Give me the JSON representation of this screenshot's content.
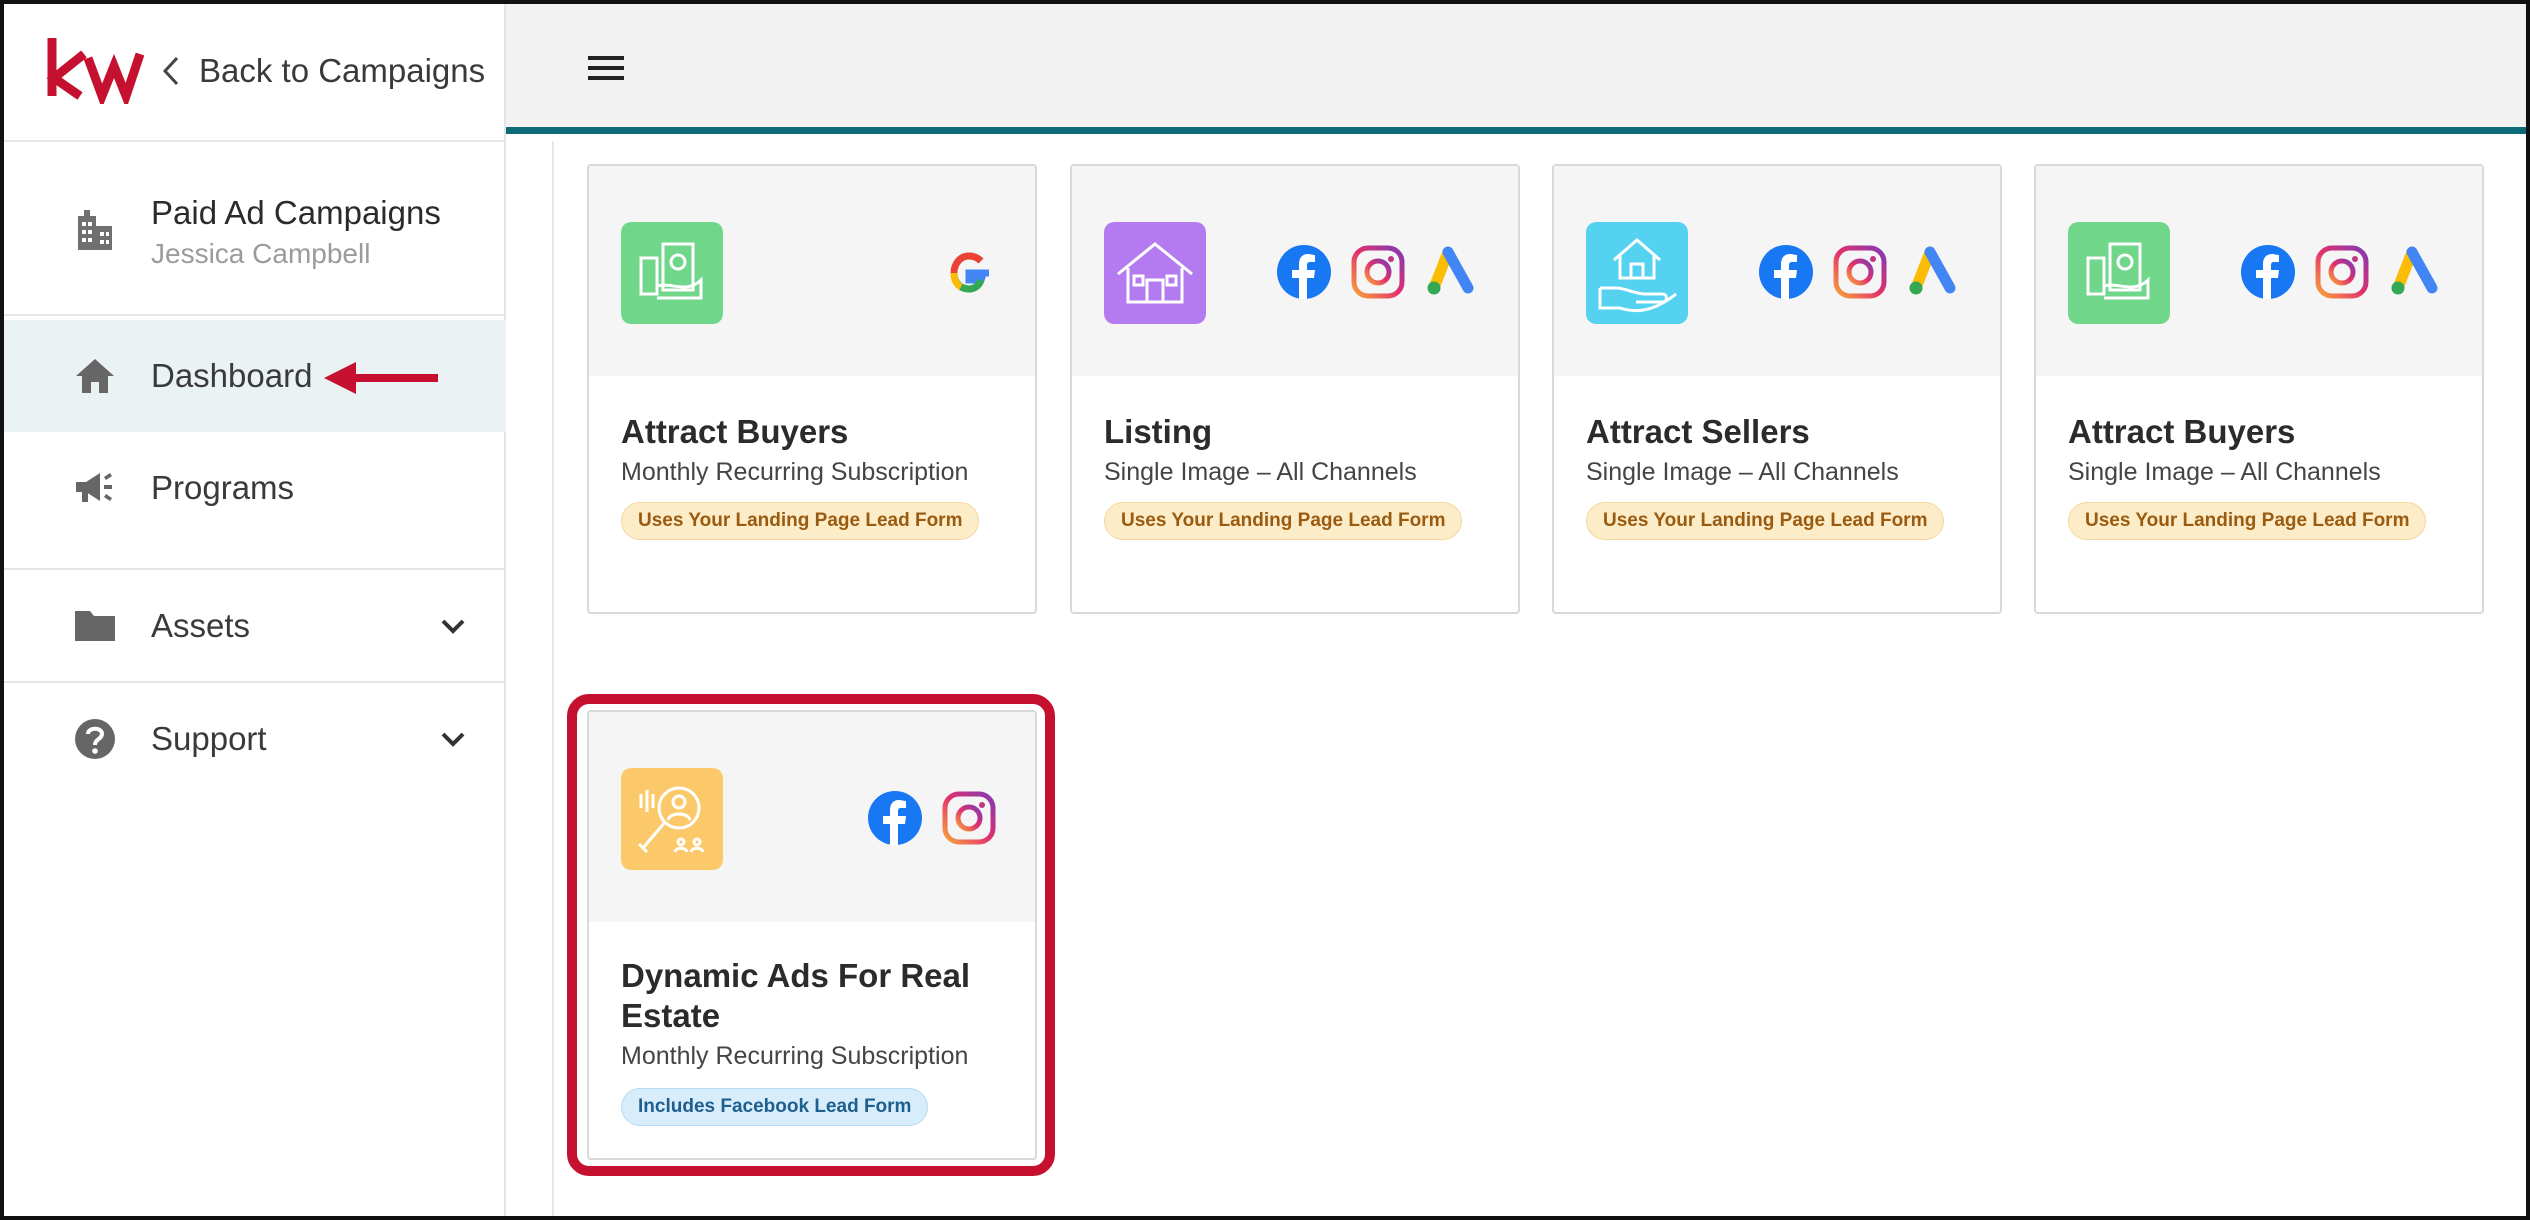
{
  "sidebar": {
    "back_label": "Back to Campaigns",
    "campaign": {
      "title": "Paid Ad Campaigns",
      "owner": "Jessica Campbell"
    },
    "nav": [
      {
        "label": "Dashboard",
        "icon": "home-icon",
        "active": true
      },
      {
        "label": "Programs",
        "icon": "megaphone-icon",
        "active": false
      },
      {
        "label": "Assets",
        "icon": "folder-icon",
        "active": false
      },
      {
        "label": "Support",
        "icon": "help-icon",
        "active": false
      }
    ]
  },
  "colors": {
    "accent_teal": "#0d6b78",
    "brand_red": "#c5102f",
    "green_icon": "#6fd68a",
    "purple_icon": "#b47bf0",
    "cyan_icon": "#55d2ef",
    "yellow_icon": "#fcc96a"
  },
  "cards": [
    {
      "title": "Attract Buyers",
      "subtitle": "Monthly Recurring Subscription",
      "badge": "Uses Your Landing Page Lead Form",
      "icon": "money-hand-icon",
      "channels": [
        "google-icon"
      ]
    },
    {
      "title": "Listing",
      "subtitle": "Single Image – All Channels",
      "badge": "Uses Your Landing Page Lead Form",
      "icon": "house-icon",
      "channels": [
        "facebook-icon",
        "instagram-icon",
        "google-ads-icon"
      ]
    },
    {
      "title": "Attract Sellers",
      "subtitle": "Single Image – All Channels",
      "badge": "Uses Your Landing Page Lead Form",
      "icon": "house-hand-icon",
      "channels": [
        "facebook-icon",
        "instagram-icon",
        "google-ads-icon"
      ]
    },
    {
      "title": "Attract Buyers",
      "subtitle": "Single Image – All Channels",
      "badge": "Uses Your Landing Page Lead Form",
      "icon": "money-hand-icon",
      "channels": [
        "facebook-icon",
        "instagram-icon",
        "google-ads-icon"
      ]
    },
    {
      "title": "Dynamic Ads For Real Estate",
      "subtitle": "Monthly Recurring Subscription",
      "badge": "Includes Facebook Lead Form",
      "icon": "search-people-icon",
      "channels": [
        "facebook-icon",
        "instagram-icon"
      ]
    }
  ]
}
